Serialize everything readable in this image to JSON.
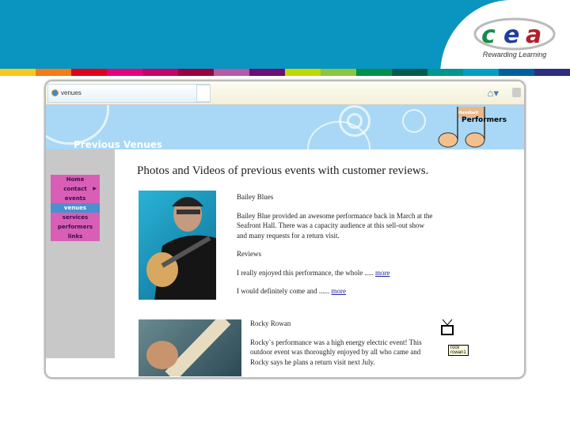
{
  "branding": {
    "logo_text": "cea",
    "tagline": "Rewarding Learning"
  },
  "strip_colors": [
    "#f7c81f",
    "#f47b16",
    "#e2001a",
    "#e6007e",
    "#c8006a",
    "#9a0040",
    "#b45aa6",
    "#6d0f74",
    "#c4d600",
    "#8cc63f",
    "#00904a",
    "#00594f",
    "#00958f",
    "#00a0c6",
    "#005fa0",
    "#2d2e83"
  ],
  "browser": {
    "tab_title": "venues"
  },
  "banner": {
    "title": "Previous Venues",
    "badge_top": "Handbell",
    "badge_label": "Performers"
  },
  "menu": [
    {
      "label": "Home"
    },
    {
      "label": "contact",
      "submenu": true
    },
    {
      "label": "events"
    },
    {
      "label": "venues",
      "active": true
    },
    {
      "label": "services"
    },
    {
      "label": "performers"
    },
    {
      "label": "links"
    }
  ],
  "main": {
    "heading": "Photos and Videos of previous events with customer reviews.",
    "performer1": {
      "name": "Bailey Blues",
      "description": "Bailey Blue provided an awesome performance back in March at the Seafront Hall. There was a capacity audience at this sell-out show and many requests for a return visit.",
      "reviews_label": "Reviews",
      "review1": "I really enjoyed this performance, the whole .....",
      "review2": "I would definitely come and ......",
      "more": "more"
    },
    "performer2": {
      "name": "Rocky Rowan",
      "description": "Rocky`s performance was a high energy electric event! This outdoor event was thoroughly enjoyed by all who came and Rocky says he plans a return visit next July.",
      "video_tooltip": "rock rowan1"
    }
  }
}
